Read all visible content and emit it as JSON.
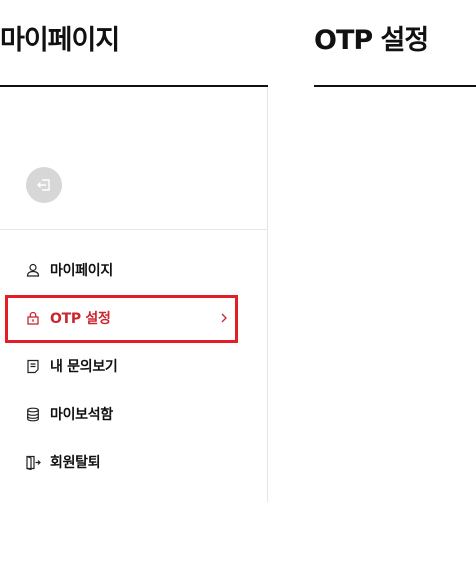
{
  "sidebar": {
    "title": "마이페이지",
    "items": [
      {
        "label": "마이페이지",
        "icon": "user-icon",
        "active": false
      },
      {
        "label": "OTP 설정",
        "icon": "lock-icon",
        "active": true
      },
      {
        "label": "내 문의보기",
        "icon": "document-icon",
        "active": false
      },
      {
        "label": "마이보석함",
        "icon": "database-icon",
        "active": false
      },
      {
        "label": "회원탈퇴",
        "icon": "exit-door-icon",
        "active": false
      }
    ]
  },
  "main": {
    "title": "OTP 설정"
  },
  "colors": {
    "accent": "#c8282d",
    "highlight_border": "#e31e25",
    "text": "#111111",
    "back_button_bg": "#d7d7d7"
  }
}
